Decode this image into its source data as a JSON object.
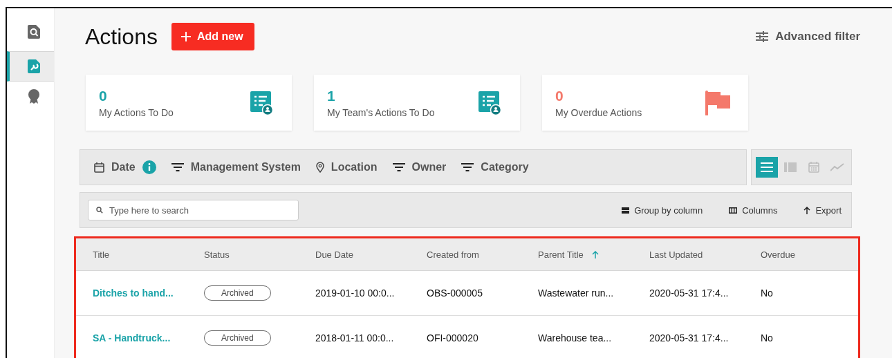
{
  "sidebar": {
    "items": [
      {
        "kind": "search-doc",
        "selected": false
      },
      {
        "kind": "wrench-doc",
        "selected": true
      },
      {
        "kind": "badge",
        "selected": false
      }
    ]
  },
  "header": {
    "title": "Actions",
    "add_button": "Add new",
    "advanced_filter": "Advanced filter"
  },
  "stats": [
    {
      "value": "0",
      "label": "My Actions To Do",
      "kind": "list"
    },
    {
      "value": "1",
      "label": "My Team's Actions To Do",
      "kind": "list"
    },
    {
      "value": "0",
      "label": "My Overdue Actions",
      "kind": "flag"
    }
  ],
  "filters": [
    {
      "label": "Date",
      "kind": "date",
      "info": true
    },
    {
      "label": "Management System",
      "kind": "filter",
      "info": false
    },
    {
      "label": "Location",
      "kind": "location",
      "info": false
    },
    {
      "label": "Owner",
      "kind": "filter",
      "info": false
    },
    {
      "label": "Category",
      "kind": "filter",
      "info": false
    }
  ],
  "views": [
    {
      "kind": "list",
      "selected": true
    },
    {
      "kind": "board",
      "selected": false
    },
    {
      "kind": "calendar",
      "selected": false
    },
    {
      "kind": "chart",
      "selected": false
    }
  ],
  "toolbar": {
    "search_placeholder": "Type here to search",
    "group_by": "Group by column",
    "columns": "Columns",
    "export": "Export"
  },
  "table": {
    "columns": [
      {
        "label": "Title",
        "sorted": false
      },
      {
        "label": "Status",
        "sorted": false
      },
      {
        "label": "Due Date",
        "sorted": false
      },
      {
        "label": "Created from",
        "sorted": false
      },
      {
        "label": "Parent Title",
        "sorted": true
      },
      {
        "label": "Last Updated",
        "sorted": false
      },
      {
        "label": "Overdue",
        "sorted": false
      }
    ],
    "rows": [
      {
        "title": "Ditches to hand...",
        "status": "Archived",
        "due_date": "2019-01-10 00:0...",
        "created_from": "OBS-000005",
        "parent_title": "Wastewater run...",
        "last_updated": "2020-05-31 17:4...",
        "overdue": "No"
      },
      {
        "title": "SA - Handtruck...",
        "status": "Archived",
        "due_date": "2018-01-11 00:0...",
        "created_from": "OFI-000020",
        "parent_title": "Warehouse tea...",
        "last_updated": "2020-05-31 17:4...",
        "overdue": "No"
      }
    ]
  }
}
